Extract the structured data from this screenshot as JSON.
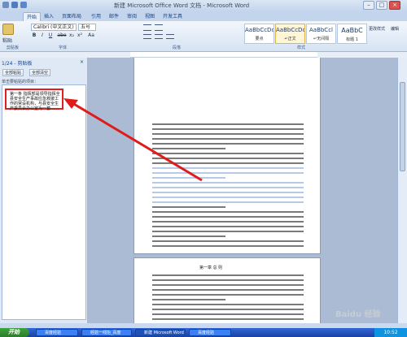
{
  "window": {
    "title": "新建 Microsoft Office Word 文档 - Microsoft Word"
  },
  "tabs": [
    "开始",
    "插入",
    "页面布局",
    "引用",
    "邮件",
    "审阅",
    "视图",
    "开发工具"
  ],
  "ribbon": {
    "paste": "粘贴",
    "font_name": "Calibri (中文正文)",
    "font_size": "五号",
    "fmt": [
      "B",
      "I",
      "U",
      "abe",
      "x₂",
      "x²",
      "Aa"
    ],
    "groups": {
      "clipboard": "剪贴板",
      "font": "字体",
      "paragraph": "段落",
      "styles": "样式"
    },
    "styles": [
      {
        "preview": "AaBbCcDc",
        "name": "要点"
      },
      {
        "preview": "AaBbCcDc",
        "name": "↵正文"
      },
      {
        "preview": "AaBbCcl",
        "name": "↵无间隔"
      },
      {
        "preview": "AaBbC",
        "name": "标题 1"
      }
    ],
    "change_styles": "更改样式",
    "edit": "编辑"
  },
  "pane": {
    "header": "1/24 - 剪贴板",
    "paste_all": "全部粘贴",
    "clear_all": "全部清空",
    "hint": "单击要粘贴的项目：",
    "item": "第一条 指挥部是领导指挥全县安全生产事故应急救援工作的常设机构，与县安全生产委员会办公室为一套……"
  },
  "doc": {
    "page_heading": "第一章  总  则"
  },
  "taskbar": {
    "start": "开始",
    "tasks": [
      {
        "label": "百度经验",
        "active": false
      },
      {
        "label": "经验一线抬_百度",
        "active": false
      },
      {
        "label": "新建 Microsoft Word",
        "active": true
      },
      {
        "label": "百度经验",
        "active": false
      }
    ],
    "clock": "10:52"
  },
  "watermark": "Baidu 经验"
}
